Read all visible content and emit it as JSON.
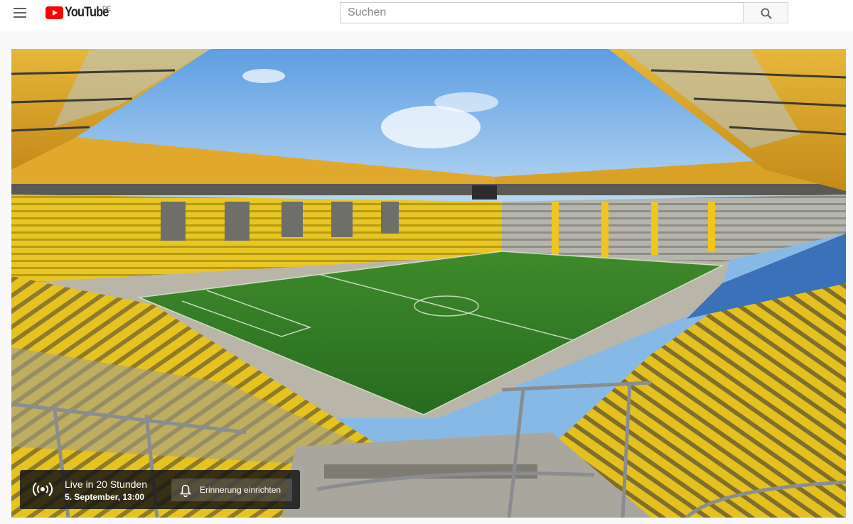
{
  "masthead": {
    "logo_text": "YouTube",
    "region_code": "DE",
    "search_placeholder": "Suchen",
    "icons": {
      "menu": "hamburger-menu-icon",
      "search": "magnifier-search-icon"
    },
    "colors": {
      "logo_red": "#ff0000",
      "background": "#ffffff"
    }
  },
  "player": {
    "thumbnail_description_icon": "stadium-thumbnail",
    "live_overlay": {
      "status": "Live in 20 Stunden",
      "scheduled": "5. September, 13:00",
      "reminder_button": "Erinnerung einrichten",
      "icons": {
        "live": "live-broadcast-icon",
        "reminder": "bell-icon"
      }
    }
  }
}
